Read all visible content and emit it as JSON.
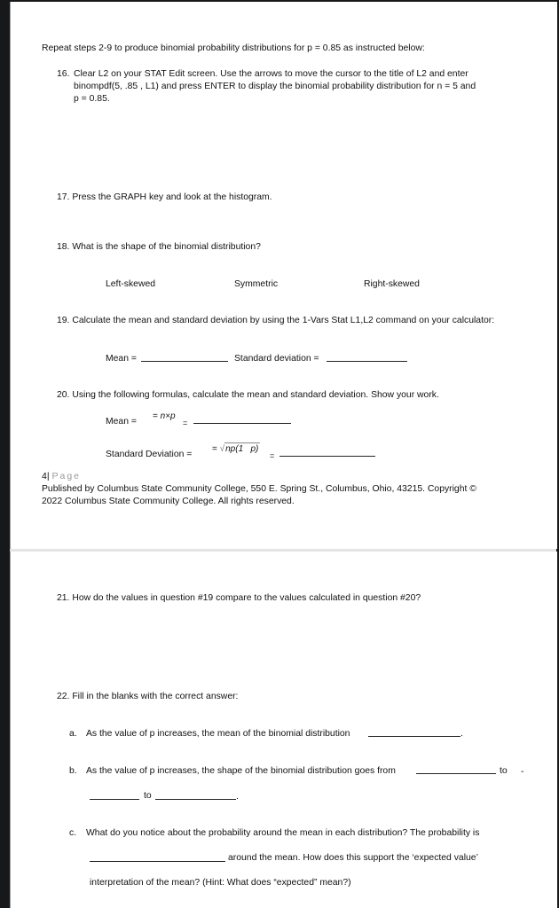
{
  "intro": "Repeat steps 2-9 to produce binomial probability distributions for p = 0.85 as instructed below:",
  "q16": {
    "number": "16.",
    "line1": "Clear L2 on your STAT Edit screen.  Use the arrows to move the cursor to the title of L2 and enter",
    "line2": "binompdf(5, .85 , L1) and press ENTER to display the binomial probability distribution for n = 5 and",
    "line3": "p = 0.85."
  },
  "q17": "17. Press the GRAPH key and look at the histogram.",
  "q18": {
    "text": "18. What is the shape of the binomial distribution?",
    "options": [
      "Left-skewed",
      "Symmetric",
      "Right-skewed"
    ]
  },
  "q19": {
    "text": "19. Calculate the mean and standard deviation by using the 1-Vars Stat L1,L2 command on your calculator:",
    "mean_label": "Mean =",
    "sd_label": "Standard deviation ="
  },
  "q20": {
    "text": "20. Using the following formulas, calculate the mean and standard deviation.  Show your work.",
    "mean_label": "Mean =",
    "mean_formula_eq": "=",
    "mean_formula": "n×p",
    "sd_label": "Standard Deviation =",
    "sd_formula_eq": "=",
    "sd_formula": "np(1   p)",
    "equals": "="
  },
  "footer": {
    "page_number": "4",
    "page_sep": "|",
    "page_word": "Page",
    "line1": "Published by Columbus State Community College, 550 E. Spring St., Columbus, Ohio, 43215. Copyright ©",
    "line2": "2022 Columbus State Community College. All rights reserved."
  },
  "q21": "21. How do the values in question #19 compare to the values calculated in question #20?",
  "q22": {
    "text": "22. Fill in the blanks with the correct answer:",
    "a": {
      "letter": "a.",
      "text": "As the value of p increases, the mean of the binomial distribution",
      "end": "."
    },
    "b": {
      "letter": "b.",
      "text": "As the value of p increases, the shape of the binomial distribution goes from",
      "to1": "to",
      "to2": "to",
      "mark": "-",
      "end": "."
    },
    "c": {
      "letter": "c.",
      "line1": "What do you notice about the probability around the mean in each distribution?  The probability is",
      "line2": "around the mean.  How does this support the ‘expected value’",
      "line3": "interpretation of the mean?  (Hint: What does “expected” mean?)"
    }
  }
}
